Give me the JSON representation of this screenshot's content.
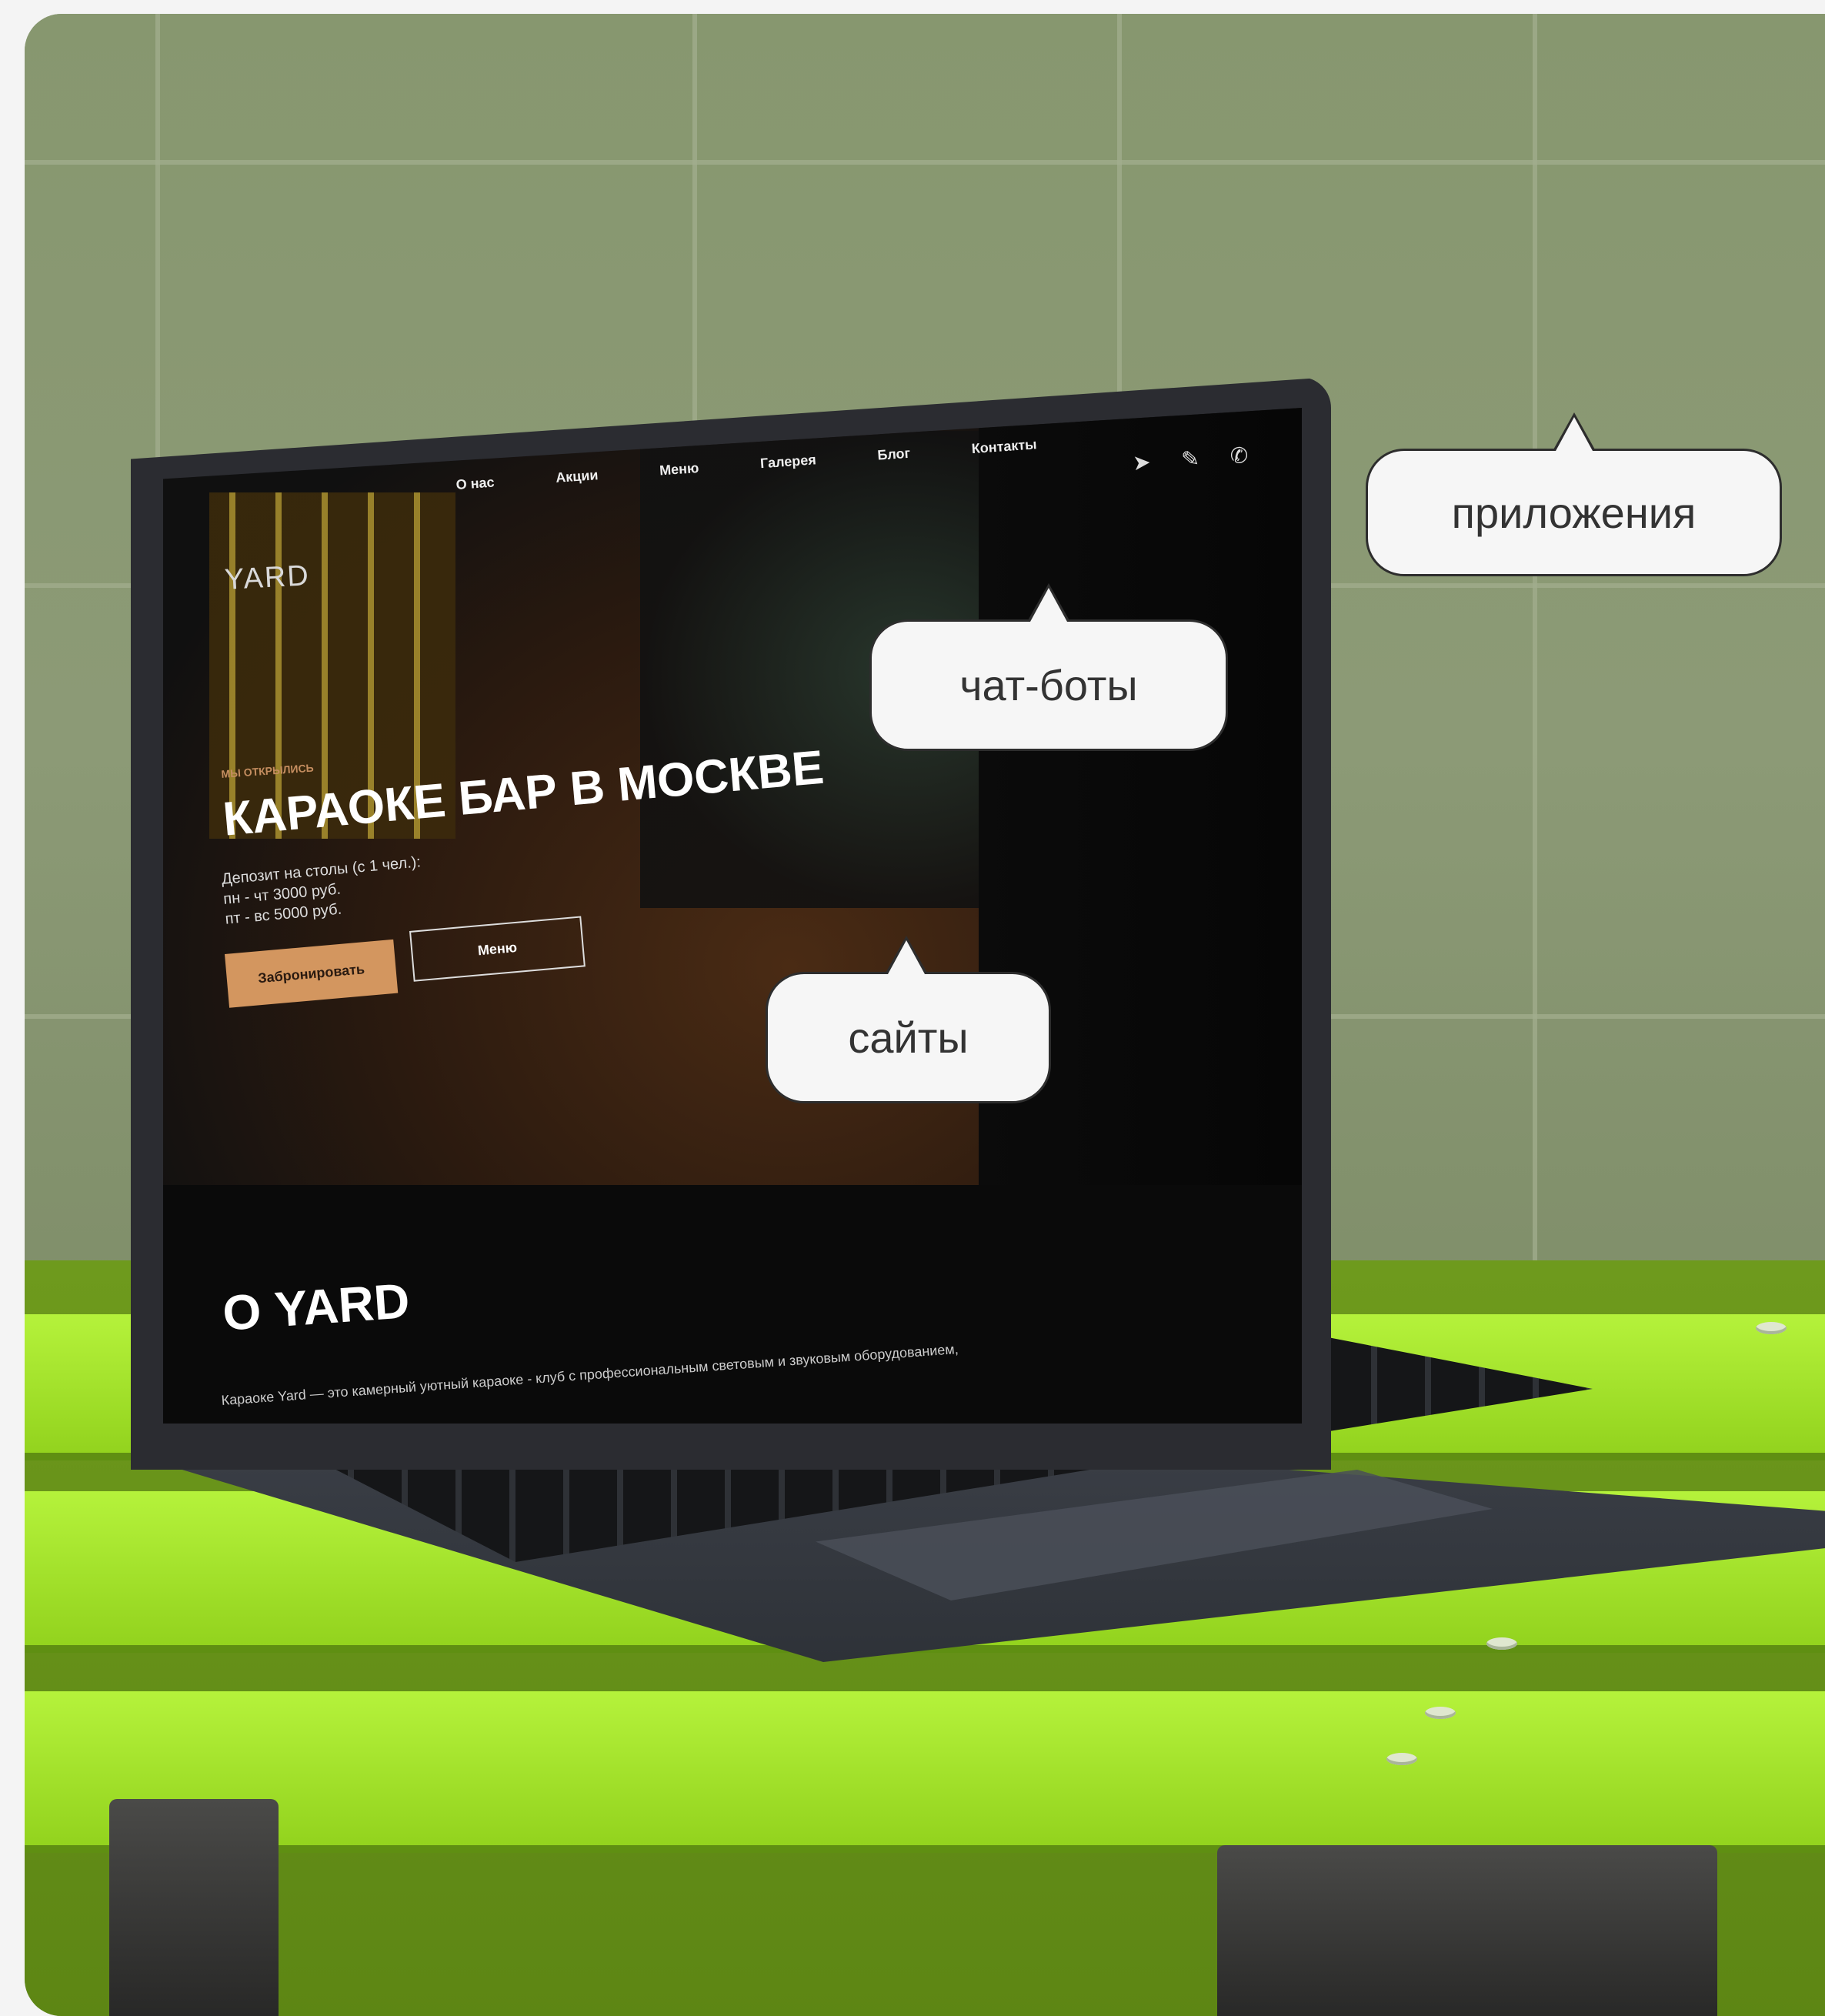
{
  "website": {
    "logo": "YARD",
    "nav": [
      "О нас",
      "Акции",
      "Меню",
      "Галерея",
      "Блог",
      "Контакты"
    ],
    "icons": [
      "telegram-icon",
      "pen-icon",
      "phone-icon"
    ],
    "hero": {
      "subtitle": "МЫ ОТКРЫЛИСЬ",
      "title": "КАРАОКЕ БАР В МОСКВЕ",
      "lines": [
        "Депозит на столы (с 1 чел.):",
        "пн - чт 3000 руб.",
        "пт - вс 5000 руб."
      ],
      "book_button": "Забронировать",
      "menu_button": "Меню"
    },
    "about": {
      "title": "О YARD",
      "text": "Караоке Yard — это камерный уютный караоке - клуб с профессиональным световым и звуковым оборудованием,"
    }
  },
  "bubbles": {
    "apps": "приложения",
    "chatbots": "чат-боты",
    "sites": "сайты"
  },
  "colors": {
    "wall": "#8d9c78",
    "bench": "#a5e632",
    "accent_button": "#d3965f"
  }
}
